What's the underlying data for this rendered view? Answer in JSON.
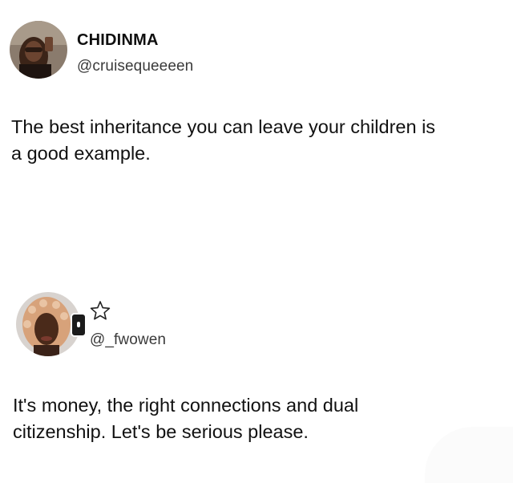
{
  "posts": [
    {
      "display_name": "CHIDINMA",
      "handle": "@cruisequeeeen",
      "text": "The best inheritance you can leave your children is\na good example.",
      "avatar_icon": "profile-photo-woman-sunglasses"
    },
    {
      "display_name": "",
      "handle": "@_fwowen",
      "text": "It's money, the right connections and dual\ncitizenship. Let's be serious please.",
      "avatar_icon": "profile-photo-woman-headscarf",
      "badge_icon": "star-outline-icon"
    }
  ],
  "colors": {
    "background": "#ffffff",
    "text": "#111111",
    "handle": "#3a3a3a"
  }
}
